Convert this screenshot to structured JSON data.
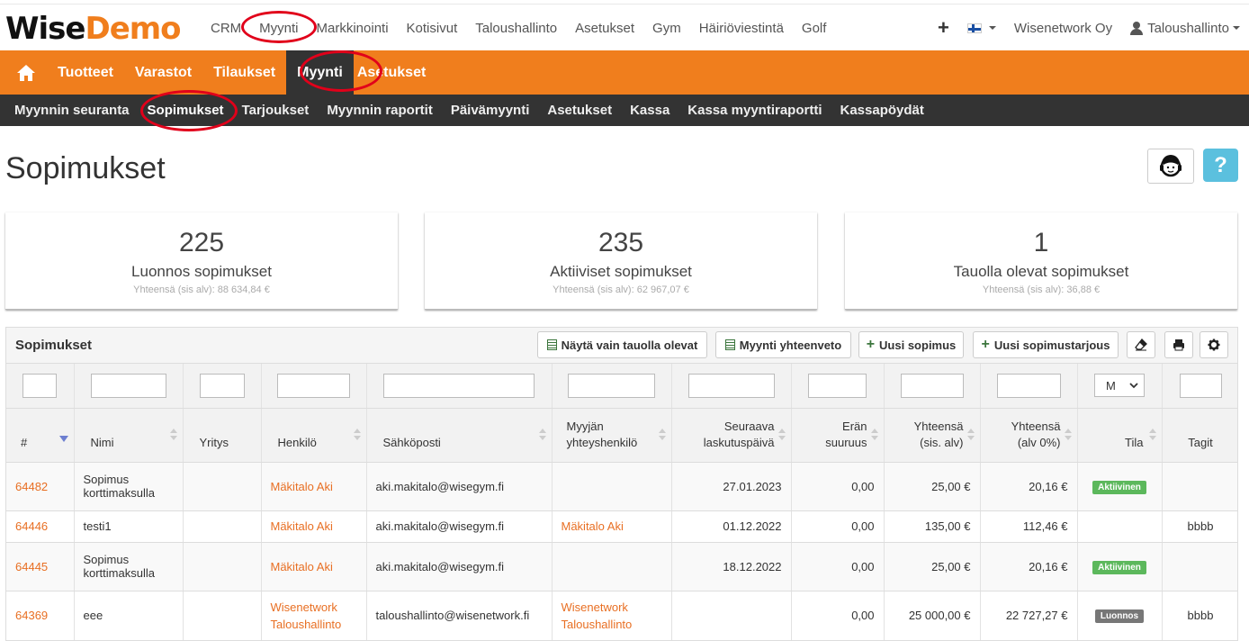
{
  "brand": {
    "wise": "Wise",
    "demo": "Demo"
  },
  "topnav": [
    "CRM",
    "Myynti",
    "Markkinointi",
    "Kotisivut",
    "Taloushallinto",
    "Asetukset",
    "Gym",
    "Häiriöviestintä",
    "Golf"
  ],
  "topright": {
    "company": "Wisenetwork Oy",
    "user": "Taloushallinto"
  },
  "mainnav": [
    "Tuotteet",
    "Varastot",
    "Tilaukset",
    "Myynti",
    "Asetukset"
  ],
  "subnav": [
    "Myynnin seuranta",
    "Sopimukset",
    "Tarjoukset",
    "Myynnin raportit",
    "Päivämyynti",
    "Asetukset",
    "Kassa",
    "Kassa myyntiraportti",
    "Kassapöydät"
  ],
  "page": {
    "title": "Sopimukset",
    "help": "?"
  },
  "stats": [
    {
      "count": "225",
      "label": "Luonnos sopimukset",
      "sub": "Yhteensä (sis alv): 88 634,84 €"
    },
    {
      "count": "235",
      "label": "Aktiiviset sopimukset",
      "sub": "Yhteensä (sis alv): 62 967,07 €"
    },
    {
      "count": "1",
      "label": "Tauolla olevat sopimukset",
      "sub": "Yhteensä (sis alv): 36,88 €"
    }
  ],
  "panel": {
    "title": "Sopimukset",
    "btn_paused": "Näytä vain tauolla olevat",
    "btn_summary": "Myynti yhteenveto",
    "btn_new": "Uusi sopimus",
    "btn_new_offer": "Uusi sopimustarjous"
  },
  "filter": {
    "status_value": "M"
  },
  "columns": [
    "#",
    "Nimi",
    "Yritys",
    "Henkilö",
    "Sähköposti",
    "Myyjän yhteyshenkilö",
    "Seuraava laskutuspäivä",
    "Erän suuruus",
    "Yhteensä (sis. alv)",
    "Yhteensä (alv 0%)",
    "Tila",
    "Tagit"
  ],
  "rows": [
    {
      "id": "64482",
      "name": "Sopimus korttimaksulla",
      "company": "",
      "person": "Mäkitalo Aki",
      "email": "aki.makitalo@wisegym.fi",
      "seller": "",
      "next": "27.01.2023",
      "batch": "0,00",
      "total": "25,00 €",
      "net": "20,16 €",
      "status": "Aktiivinen",
      "tags": ""
    },
    {
      "id": "64446",
      "name": "testi1",
      "company": "",
      "person": "Mäkitalo Aki",
      "email": "aki.makitalo@wisegym.fi",
      "seller": "Mäkitalo Aki",
      "next": "01.12.2022",
      "batch": "0,00",
      "total": "135,00 €",
      "net": "112,46 €",
      "status": "",
      "tags": "bbbb"
    },
    {
      "id": "64445",
      "name": "Sopimus korttimaksulla",
      "company": "",
      "person": "Mäkitalo Aki",
      "email": "aki.makitalo@wisegym.fi",
      "seller": "",
      "next": "18.12.2022",
      "batch": "0,00",
      "total": "25,00 €",
      "net": "20,16 €",
      "status": "Aktiivinen",
      "tags": ""
    },
    {
      "id": "64369",
      "name": "eee",
      "company": "",
      "person": "Wisenetwork Taloushallinto",
      "email": "taloushallinto@wisenetwork.fi",
      "seller": "Wisenetwork Taloushallinto",
      "next": "",
      "batch": "0,00",
      "total": "25 000,00 €",
      "net": "22 727,27 €",
      "status": "Luonnos",
      "tags": "bbbb"
    }
  ]
}
